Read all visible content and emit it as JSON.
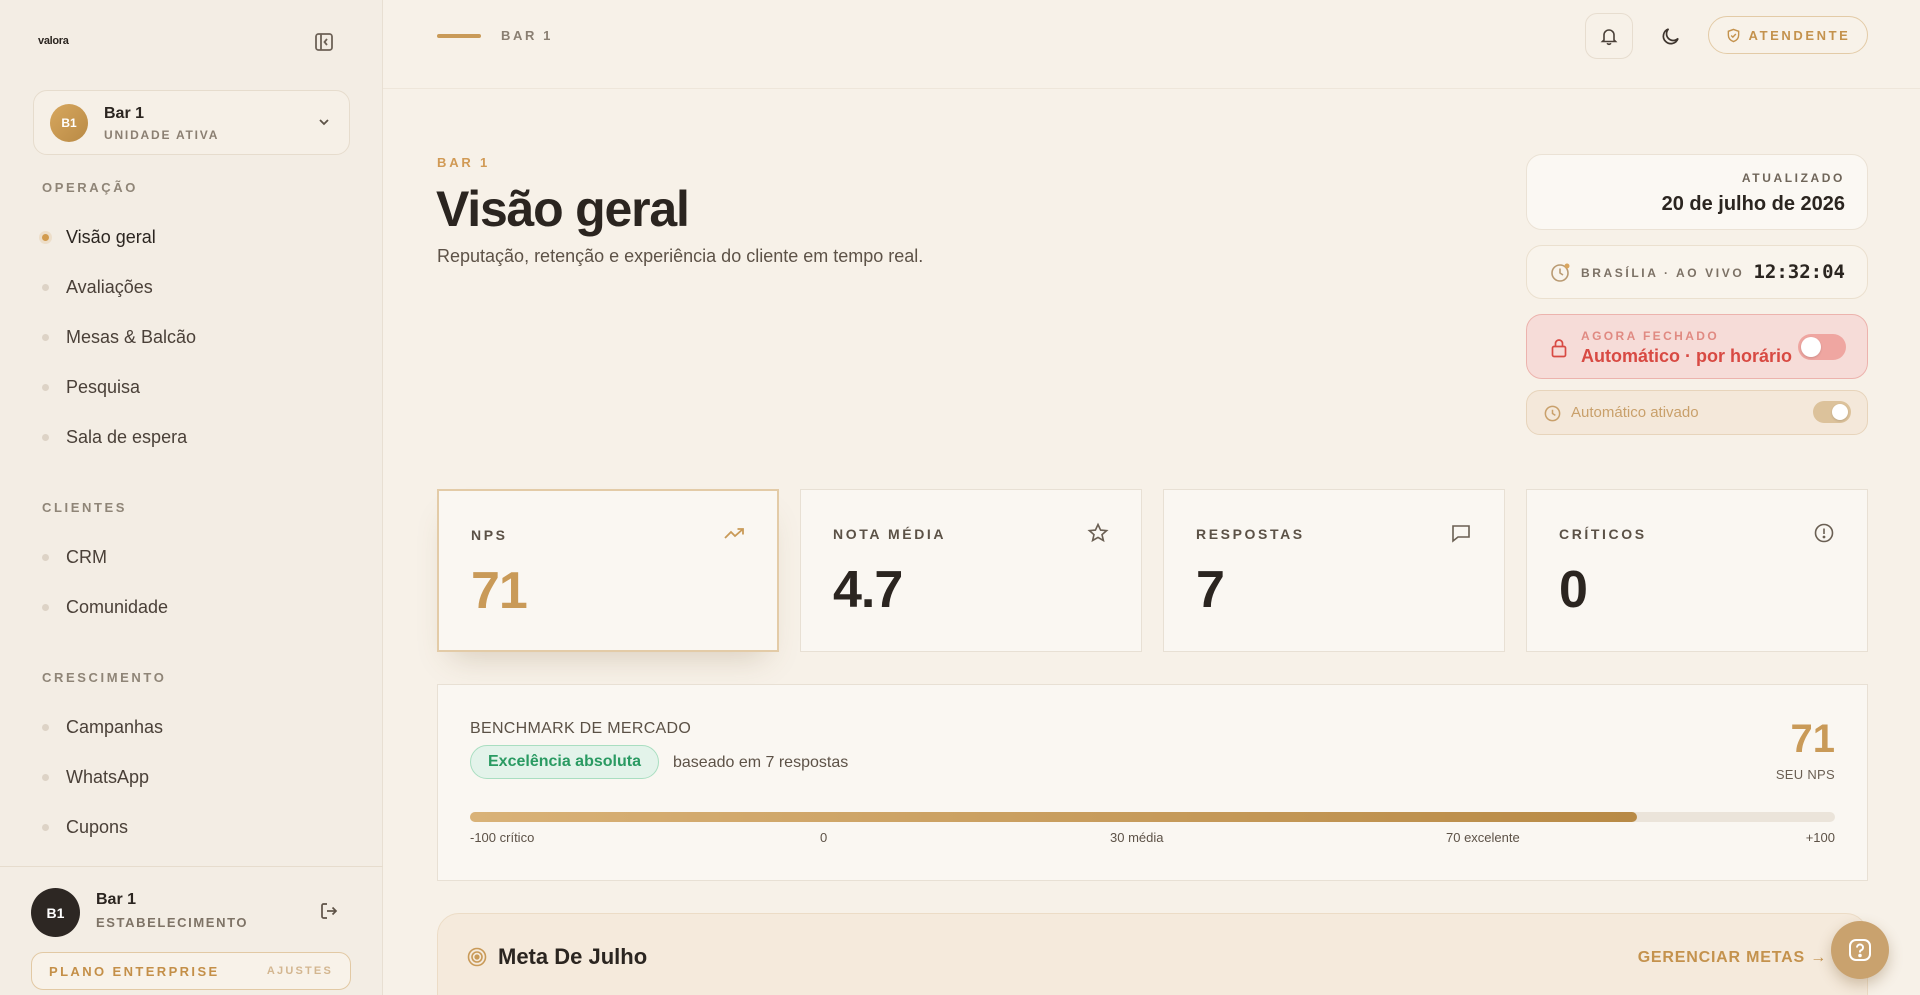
{
  "app": {
    "logo": "valora"
  },
  "unit": {
    "initials": "B1",
    "name": "Bar 1",
    "subtitle": "UNIDADE ATIVA"
  },
  "sidebar": {
    "sections": [
      {
        "title": "OPERAÇÃO",
        "items": [
          "Visão geral",
          "Avaliações",
          "Mesas & Balcão",
          "Pesquisa",
          "Sala de espera"
        ]
      },
      {
        "title": "CLIENTES",
        "items": [
          "CRM",
          "Comunidade"
        ]
      },
      {
        "title": "CRESCIMENTO",
        "items": [
          "Campanhas",
          "WhatsApp",
          "Cupons"
        ]
      }
    ],
    "active": "Visão geral"
  },
  "user": {
    "initials": "B1",
    "name": "Bar 1",
    "subtitle": "ESTABELECIMENTO"
  },
  "plan": {
    "label": "PLANO ENTERPRISE",
    "settings": "AJUSTES"
  },
  "topbar": {
    "breadcrumb": "BAR 1",
    "role": "ATENDENTE"
  },
  "header": {
    "eyebrow": "BAR 1",
    "title": "Visão geral",
    "subtitle": "Reputação, retenção e experiência do cliente em tempo real."
  },
  "status": {
    "updated_label": "ATUALIZADO",
    "updated_date": "20 de julho de 2026",
    "clock_label": "BRASÍLIA · AO VIVO",
    "clock_time": "12:32:04",
    "closed_label": "AGORA FECHADO",
    "closed_mode": "Automático · por horário",
    "auto_label": "Automático ativado"
  },
  "stats": [
    {
      "label": "NPS",
      "value": "71",
      "icon": "trending-up-icon"
    },
    {
      "label": "NOTA MÉDIA",
      "value": "4.7",
      "icon": "star-icon"
    },
    {
      "label": "RESPOSTAS",
      "value": "7",
      "icon": "message-icon"
    },
    {
      "label": "CRÍTICOS",
      "value": "0",
      "icon": "alert-circle-icon"
    }
  ],
  "benchmark": {
    "title": "BENCHMARK DE MERCADO",
    "badge": "Excelência absoluta",
    "basis": "baseado em 7 respostas",
    "score": "71",
    "score_label": "SEU NPS",
    "nps_value": 71,
    "scale_min": -100,
    "scale_max": 100,
    "ticks": [
      "-100 crítico",
      "0",
      "30 média",
      "70 excelente",
      "+100"
    ]
  },
  "goals": {
    "title": "Meta De Julho",
    "link": "GERENCIAR METAS →"
  },
  "colors": {
    "accent": "#c99a58",
    "danger": "#d84a43",
    "success": "#2a9a62"
  }
}
